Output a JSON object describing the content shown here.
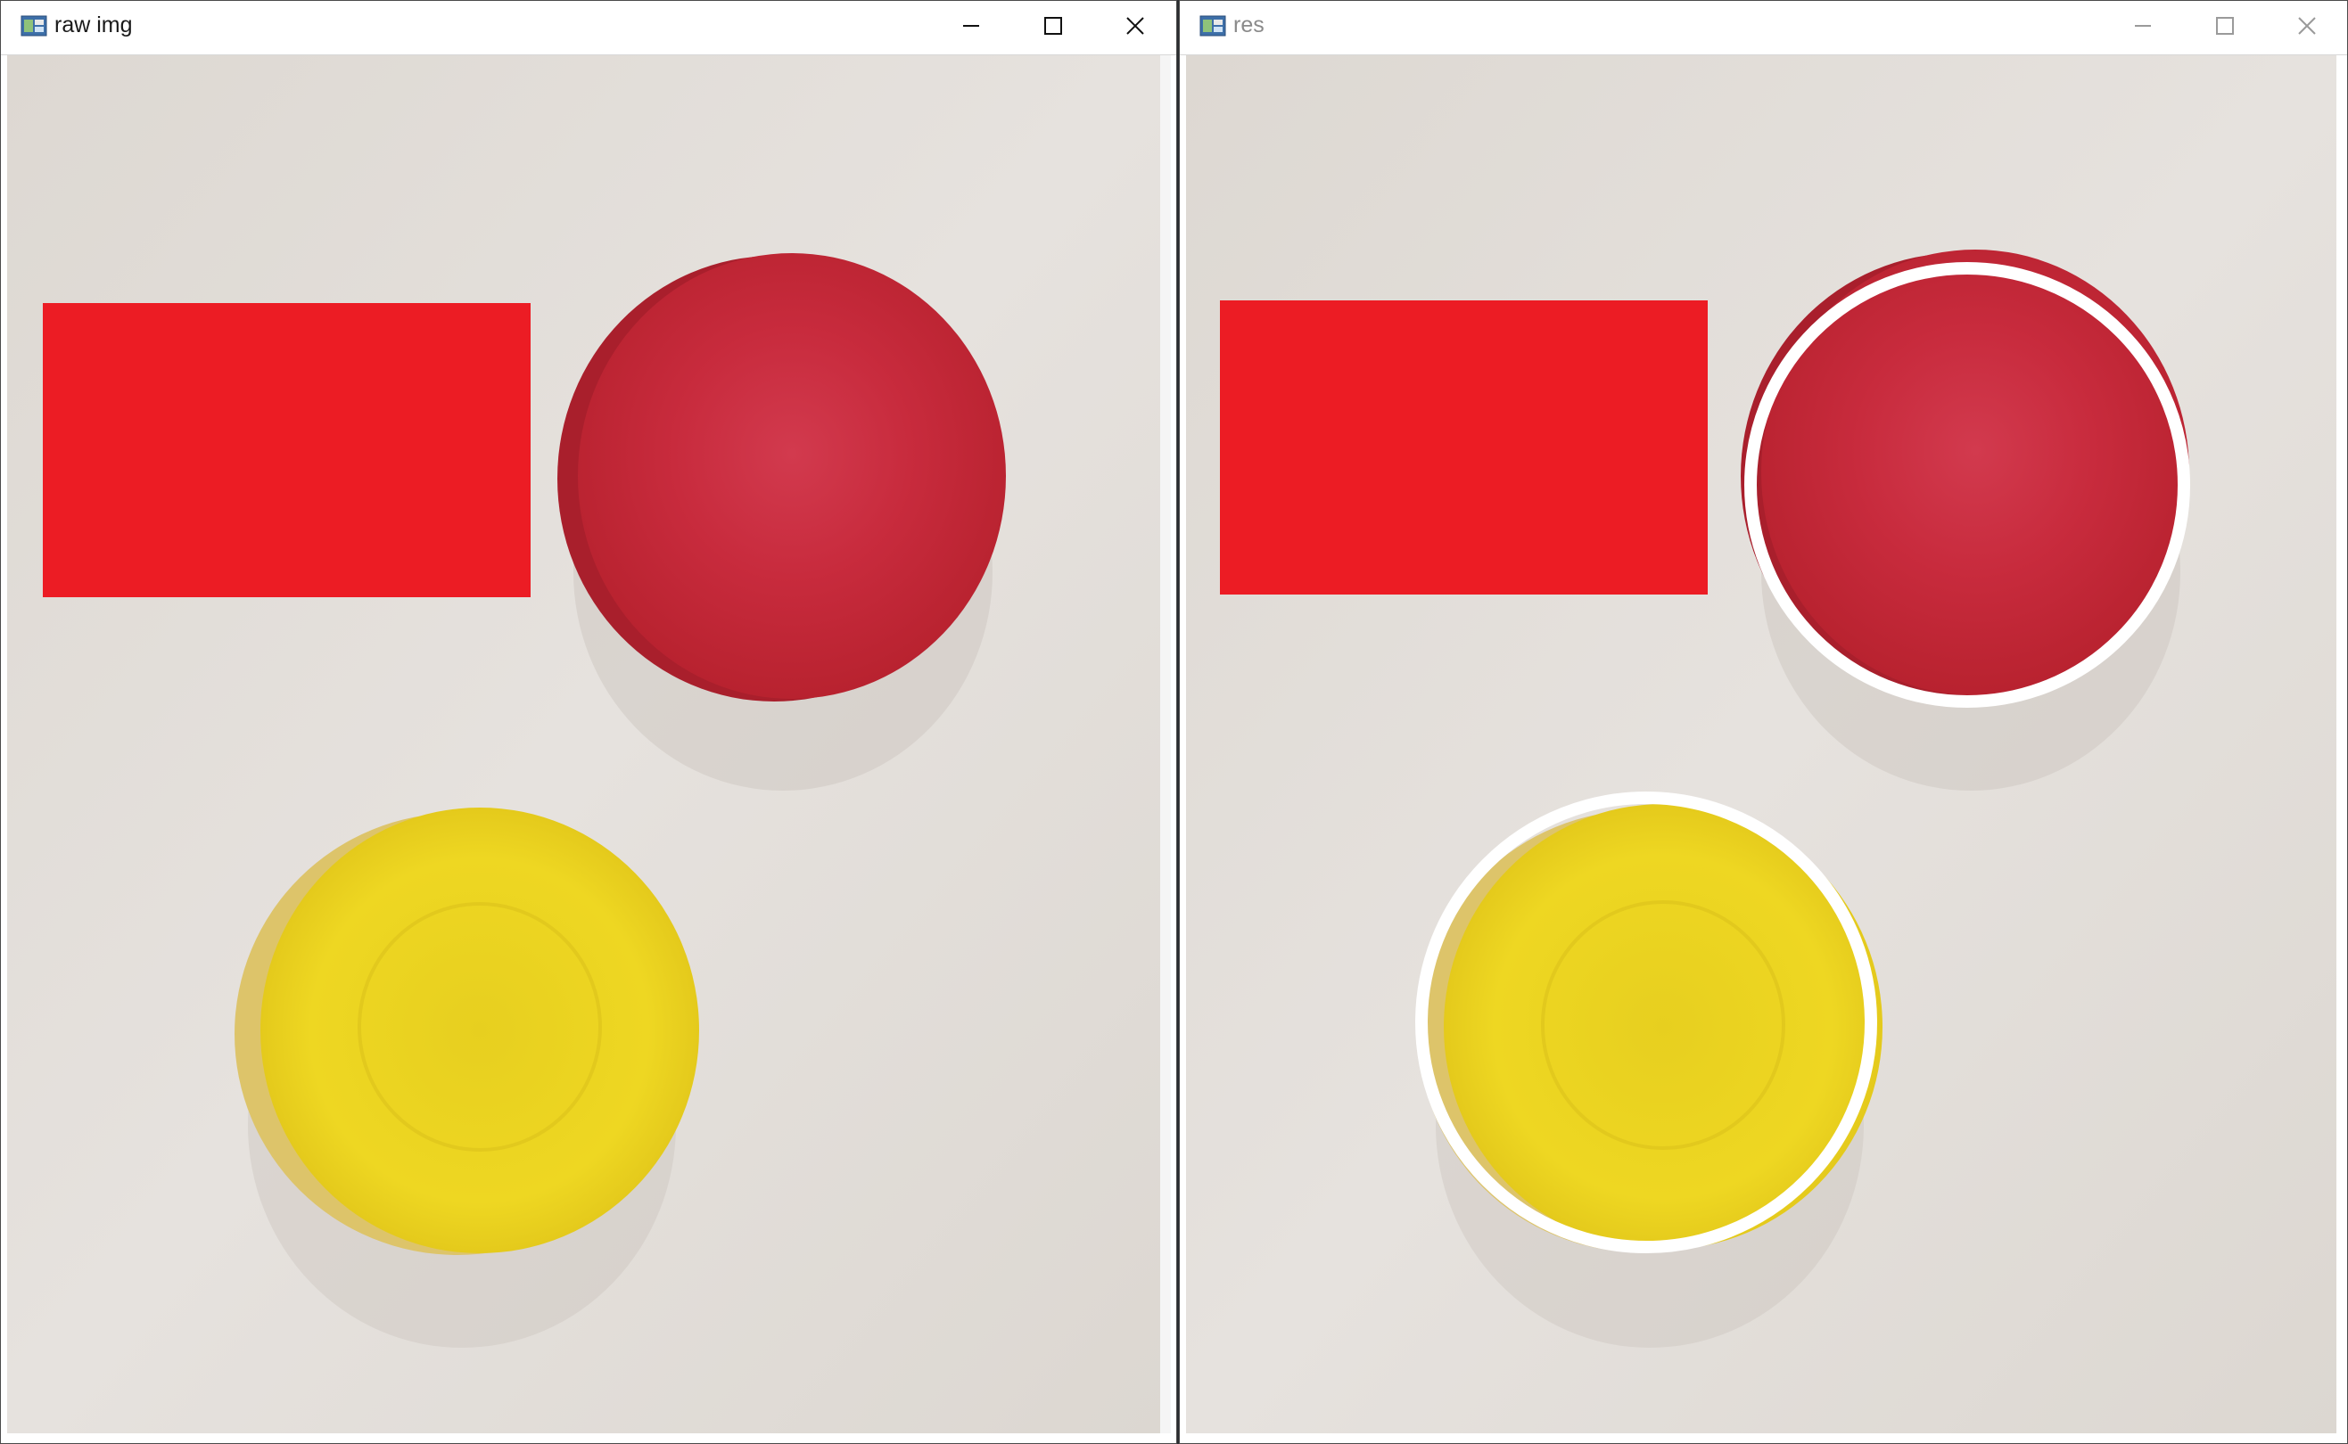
{
  "windows": [
    {
      "id": "raw",
      "title": "raw img",
      "title_active": true,
      "detected_circles": false
    },
    {
      "id": "res",
      "title": "res",
      "title_active": false,
      "detected_circles": true
    }
  ],
  "colors": {
    "table_surface": "#e4e0dc",
    "red_rectangle": "#ec1c24",
    "red_disc": "#c8283a",
    "yellow_disc": "#e8d01e",
    "circle_outline": "#ffffff"
  },
  "icons": {
    "app": "opencv-window-icon",
    "minimize": "minimize-icon",
    "maximize": "maximize-icon",
    "close": "close-icon"
  }
}
